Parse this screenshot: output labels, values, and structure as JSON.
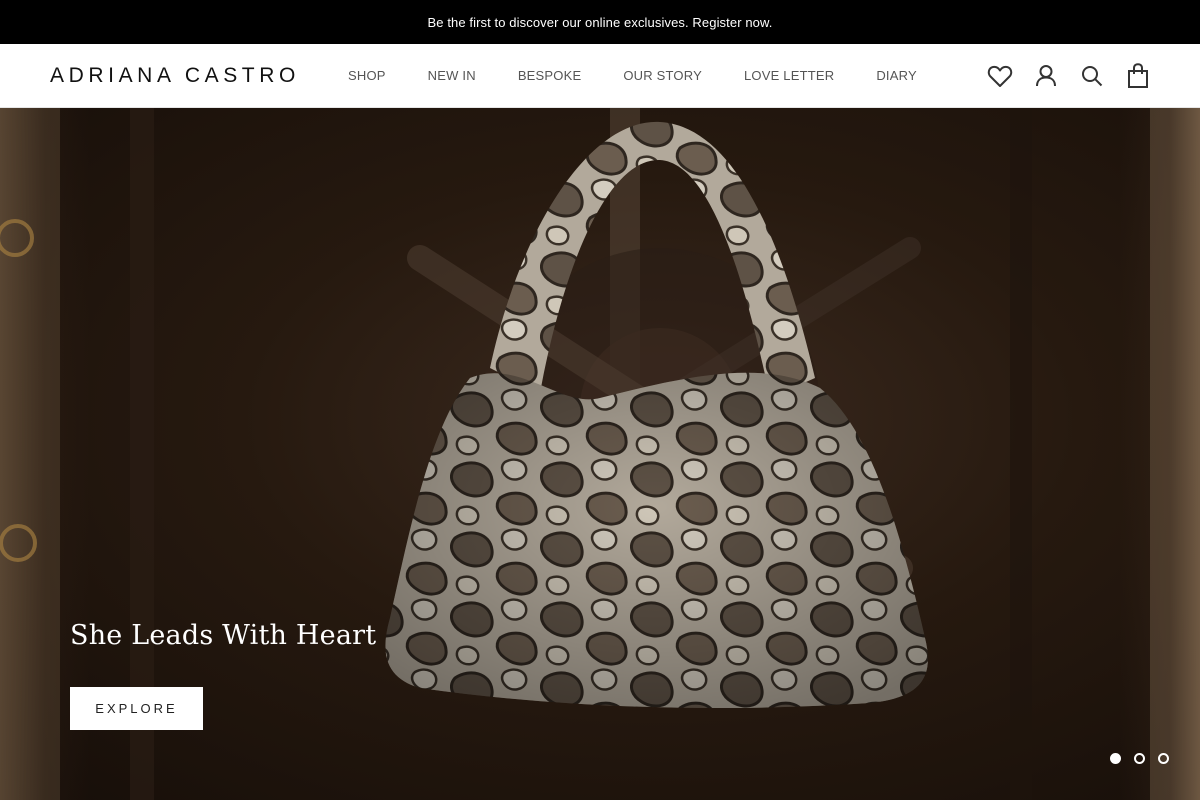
{
  "announcement": {
    "text": "Be the first to discover our online exclusives. Register now."
  },
  "header": {
    "logo": "ADRIANA CASTRO",
    "nav": [
      "SHOP",
      "NEW IN",
      "BESPOKE",
      "OUR STORY",
      "LOVE LETTER",
      "DIARY"
    ],
    "icons": [
      "heart-icon",
      "account-icon",
      "search-icon",
      "bag-icon"
    ]
  },
  "hero": {
    "headline": "She Leads With Heart",
    "cta_label": "EXPLORE",
    "slides": {
      "count": 3,
      "active": 1
    }
  },
  "colors": {
    "announcement_bg": "#000000",
    "header_bg": "#ffffff",
    "text_dark": "#111111",
    "hero_bg": "#26190f"
  }
}
